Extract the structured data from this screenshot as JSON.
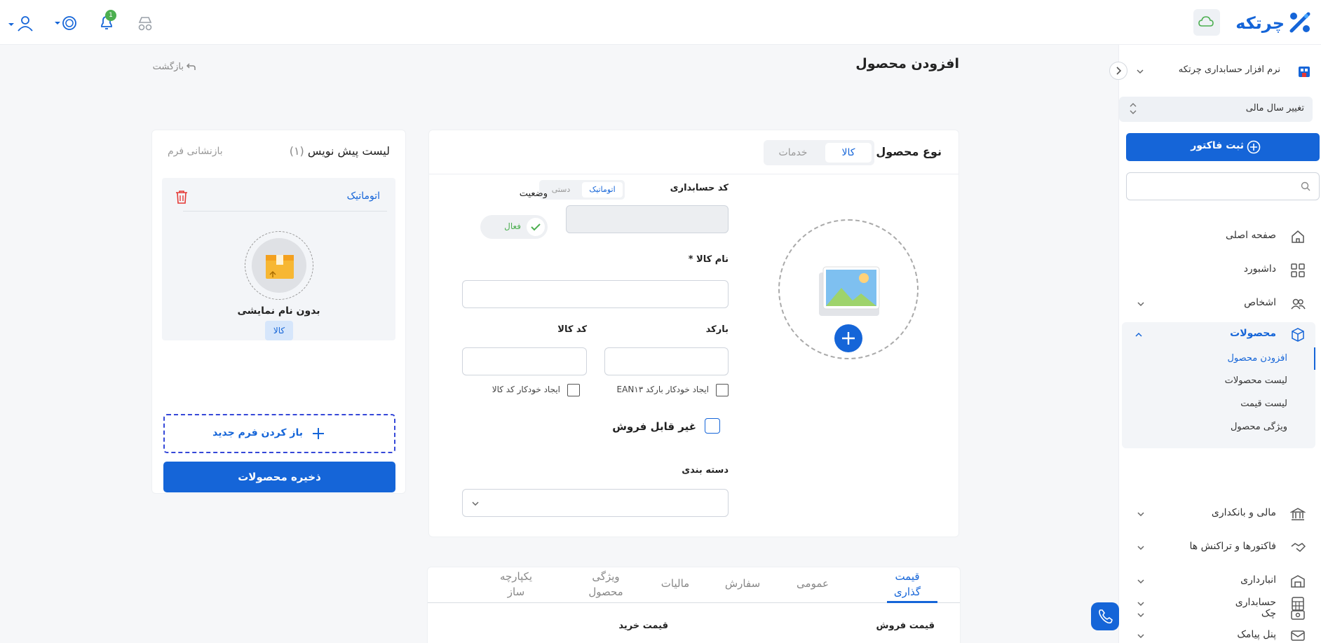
{
  "app": {
    "brand_name": "چرتکه",
    "colors": {
      "primary": "#1565d8",
      "danger": "#e53935",
      "success": "#4caf50",
      "text": "#222222"
    }
  },
  "topbar": {
    "notification_count": "1",
    "icons": [
      "user-icon",
      "coin-icon",
      "bell-icon",
      "incognito-icon",
      "cloud-icon"
    ]
  },
  "sidebar": {
    "company_name": "نرم افزار حسابداری چرتکه",
    "fiscal_year_label": "تغییر سال مالی",
    "register_invoice_label": "ثبت فاکتور",
    "search_placeholder": "",
    "nav": {
      "home": "صفحه اصلی",
      "dashboard": "داشبورد",
      "people": "اشخاص",
      "products": "محصولات",
      "finance": "مالی و بانکداری",
      "invoices": "فاکتورها و تراکنش ها",
      "warehouse": "انبارداری",
      "cheque": "چک",
      "accounting": "حسابداری",
      "sms": "پنل پیامک"
    },
    "products_sub": {
      "add_product": "افزودن محصول",
      "product_list": "لیست محصولات",
      "price_list": "لیست قیمت",
      "product_feature": "ویژگی محصول"
    }
  },
  "page": {
    "title": "افزودن محصول",
    "back_label": "بازگشت"
  },
  "form": {
    "product_type_label": "نوع محصول",
    "type_goods": "کالا",
    "type_services": "خدمات",
    "accounting_code_label": "کد حسابداری",
    "mode_auto": "اتوماتیک",
    "mode_manual": "دستی",
    "status_label": "وضعیت",
    "status_active": "فعال",
    "product_name_label": "نام کالا *",
    "barcode_label": "بارکد",
    "product_code_label": "کد کالا",
    "auto_barcode_label": "ایجاد خودکار بارکد EAN۱۳",
    "auto_code_label": "ایجاد خودکار کد کالا",
    "not_sellable_label": "غیر قابل فروش",
    "category_label": "دسته بندی"
  },
  "tabs": [
    {
      "label": "قیمت گذاری",
      "active": true
    },
    {
      "label": "عمومی"
    },
    {
      "label": "سفارش"
    },
    {
      "label": "مالیات"
    },
    {
      "label": "ویژگی محصول"
    },
    {
      "label": "یکپارچه ساز"
    }
  ],
  "pricing": {
    "sale_price_label": "قیمت فروش",
    "purchase_price_label": "قیمت خرید"
  },
  "draft": {
    "title": "لیست پیش نویس",
    "count": "(۱)",
    "reset_label": "بازنشانی فرم",
    "item_mode": "اتوماتیک",
    "item_name": "بدون نام نمایشی",
    "item_type": "کالا",
    "open_new_form_label": "باز کردن فرم جدید",
    "save_products_label": "ذخیره محصولات"
  }
}
